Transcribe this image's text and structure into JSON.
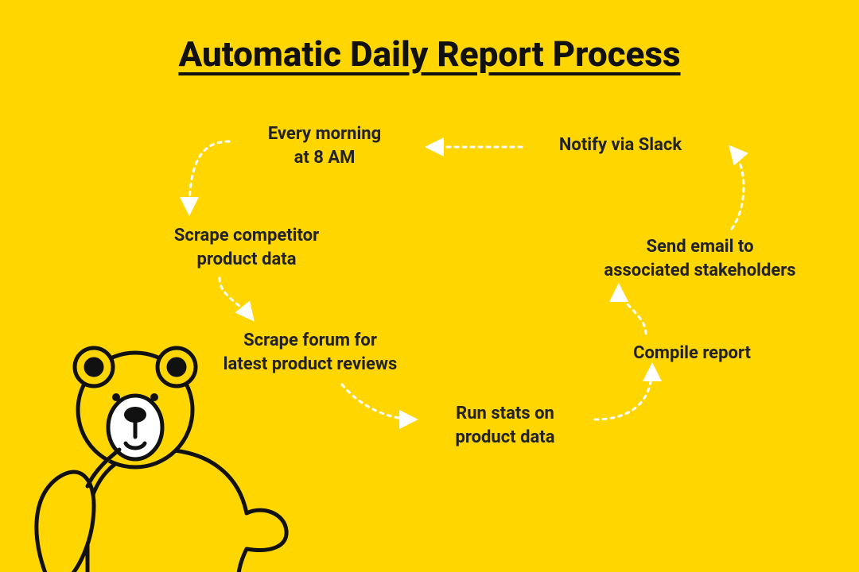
{
  "title": "Automatic Daily Report Process",
  "steps": {
    "trigger": "Every morning\nat 8 AM",
    "scrape_competitor": "Scrape competitor\nproduct data",
    "scrape_forum": "Scrape forum for\nlatest product reviews",
    "run_stats": "Run stats on\nproduct data",
    "compile_report": "Compile report",
    "send_email": "Send email to\nassociated stakeholders",
    "notify_slack": "Notify via Slack"
  },
  "colors": {
    "background": "#ffd600",
    "text": "#111111",
    "arrow": "#ffffff"
  }
}
